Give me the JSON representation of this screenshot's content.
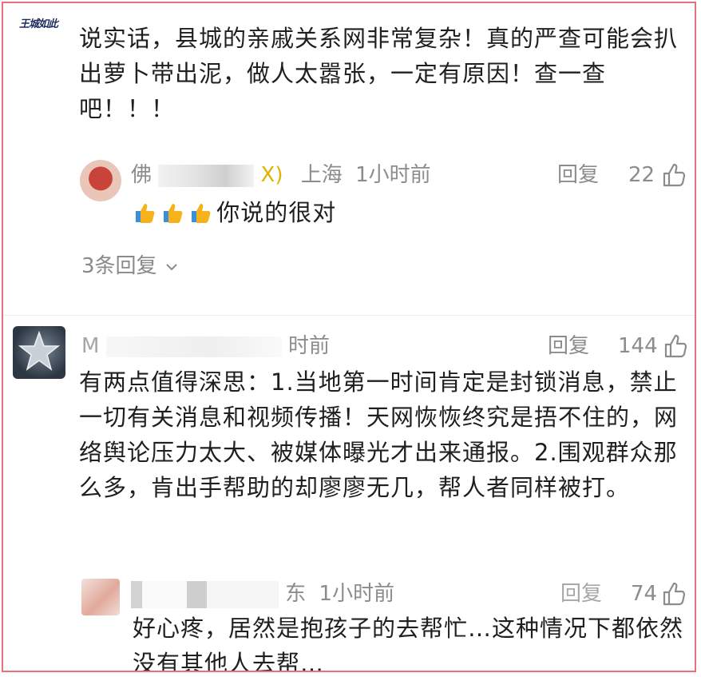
{
  "comment1": {
    "avatar_logo_text": "王城如此",
    "text": "说实话，县城的亲戚关系网非常复杂！真的严查可能会扒出萝卜带出泥，做人太嚣张，一定有原因！查一查吧！！！",
    "reply": {
      "name_visible": "佛",
      "name_tail": "X)",
      "location": "上海",
      "time": "1小时前",
      "reply_label": "回复",
      "like_count": "22",
      "emoji_name": "thumbs-up",
      "text": "你说的很对"
    },
    "more_replies": "3条回复"
  },
  "comment2": {
    "name_visible": "M",
    "time_tail": "时前",
    "reply_label": "回复",
    "like_count": "144",
    "text": "有两点值得深思：1.当地第一时间肯定是封锁消息，禁止一切有关消息和视频传播！天网恢恢终究是捂不住的，网络舆论压力太大、被媒体曝光才出来通报。2.围观群众那么多，肯出手帮助的却廖廖无几，帮人者同样被打。",
    "reply": {
      "location_tail": "东",
      "time": "1小时前",
      "reply_label": "回复",
      "like_count": "74",
      "text": "好心疼，居然是抱孩子的去帮忙…这种情况下都依然没有其他人去帮…"
    }
  },
  "colors": {
    "frame_border": "#e8707a",
    "meta_gray": "#8c8c8c",
    "text": "#1f1f1f"
  }
}
